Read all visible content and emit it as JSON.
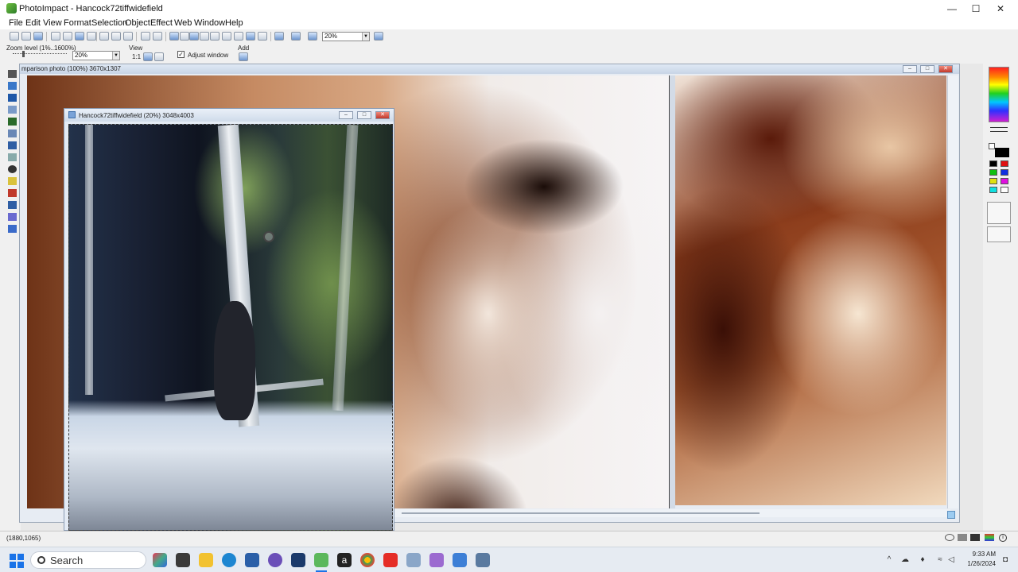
{
  "app": {
    "window_title": "PhotoImpact - Hancock72tiffwidefield",
    "controls": {
      "minimize": "—",
      "maximize": "☐",
      "close": "✕"
    }
  },
  "menu": [
    "File",
    "Edit",
    "View",
    "Format",
    "Selection",
    "Object",
    "Effect",
    "Web",
    "Window",
    "Help"
  ],
  "toolbar": {
    "zoom_combo": "20%"
  },
  "attribute_bar": {
    "zoom_level_label": "Zoom level (1%..1600%)",
    "zoom_value": "20%",
    "view_label": "View",
    "view_ratio": "1:1",
    "adjust_window_label": "Adjust window",
    "adjust_window_checked": true,
    "add_label": "Add"
  },
  "windows": {
    "comparison": {
      "title": "mparison photo (100%) 3670x1307"
    },
    "hancock": {
      "title": "Hancock72tiffwidefield (20%) 3048x4003"
    }
  },
  "statusbar": {
    "coords": "(1880,1065)"
  },
  "taskbar": {
    "search_label": "Search",
    "time": "9:33 AM",
    "date": "1/26/2024"
  }
}
